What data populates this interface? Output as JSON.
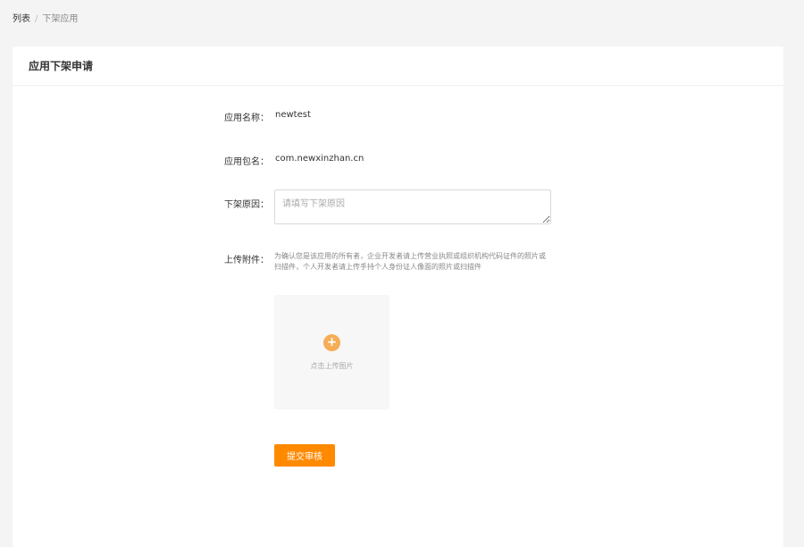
{
  "breadcrumb": {
    "parent": "列表",
    "separator": "/",
    "current": "下架应用"
  },
  "card": {
    "title": "应用下架申请"
  },
  "form": {
    "app_name_label": "应用名称：",
    "app_name_value": "newtest",
    "package_label": "应用包名：",
    "package_value": "com.newxinzhan.cn",
    "reason_label": "下架原因：",
    "reason_placeholder": "请填写下架原因",
    "reason_value": "",
    "attachment_label": "上传附件：",
    "attachment_hint": "为确认您是该应用的所有者，企业开发者请上传营业执照或组织机构代码证件的照片或扫描件，个人开发者请上传手持个人身份证人像面的照片或扫描件",
    "upload_icon": "plus-icon",
    "upload_text": "点击上传图片",
    "submit_label": "提交审核"
  },
  "colors": {
    "accent": "#ff8a00",
    "upload_icon_bg": "#f6ad55",
    "page_bg": "#f4f4f4",
    "card_bg": "#ffffff"
  }
}
